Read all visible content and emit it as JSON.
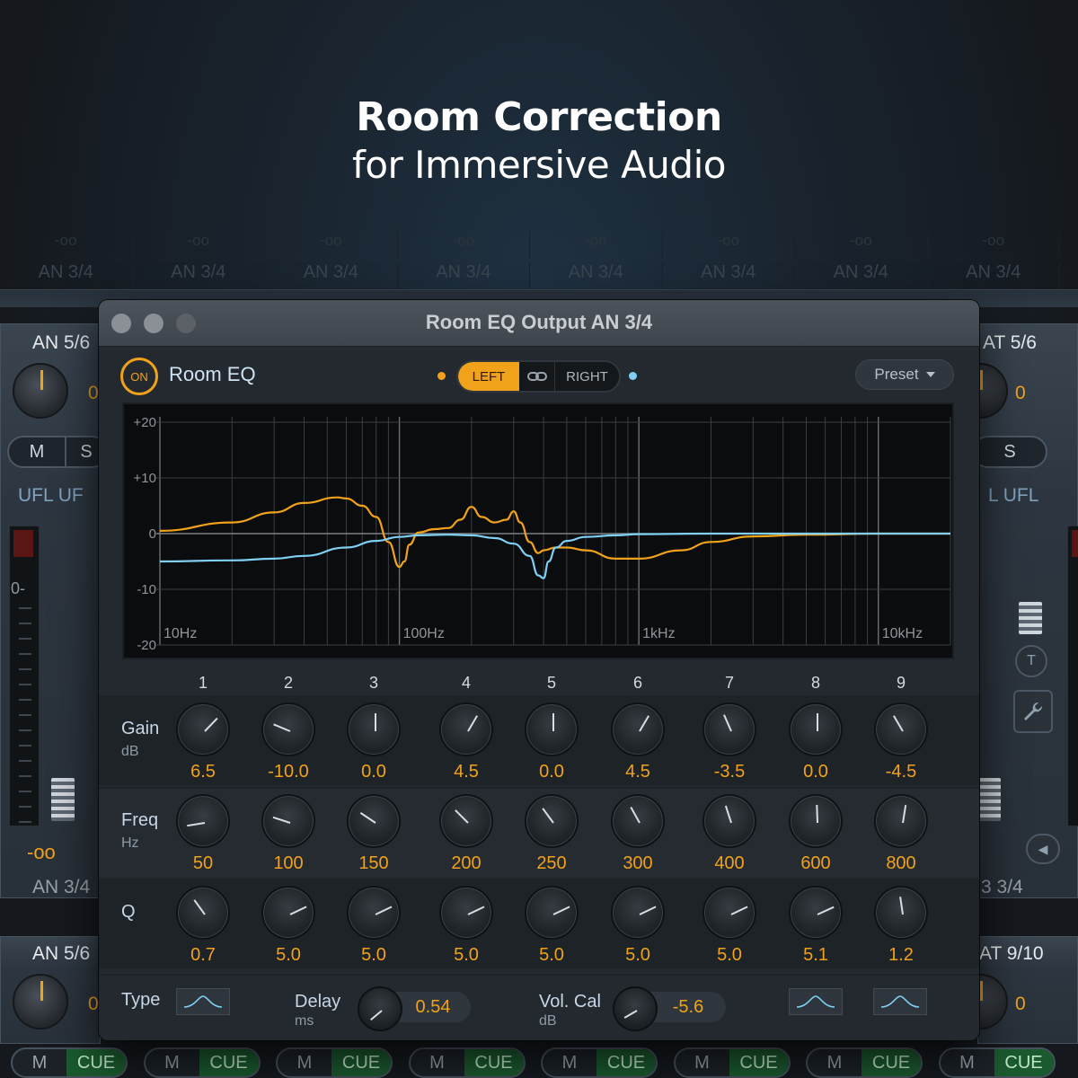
{
  "headline": {
    "line1": "Room Correction",
    "line2": "for Immersive Audio"
  },
  "ghost": {
    "db": [
      "-oo",
      "-oo",
      "-oo",
      "-oo",
      "-oo",
      "-oo",
      "-oo",
      "-oo"
    ],
    "channels": [
      "AN 3/4",
      "AN 3/4",
      "AN 3/4",
      "AN 3/4",
      "AN 3/4",
      "AN 3/4",
      "AN 3/4",
      "AN 3/4"
    ]
  },
  "mixer": {
    "left_strip": {
      "name": "AN 5/6",
      "value": "0",
      "mute": "M",
      "solo": "S",
      "routing": "UFL   UF",
      "meter_zero": "0-",
      "level": "-oo",
      "bottom_name": "AN 3/4",
      "lower_name": "AN 5/6",
      "lower_value": "0"
    },
    "right_strip": {
      "name": "AT 5/6",
      "value": "0",
      "solo": "S",
      "routing": "L  UFL",
      "t_button": "T",
      "bottom_name": "3 3/4",
      "lower_name": "AT 9/10",
      "lower_value": "0"
    },
    "bottom_pills": [
      {
        "m": "M",
        "cue": "CUE"
      },
      {
        "m": "M",
        "cue": "CUE"
      },
      {
        "m": "M",
        "cue": "CUE"
      },
      {
        "m": "M",
        "cue": "CUE"
      },
      {
        "m": "M",
        "cue": "CUE"
      },
      {
        "m": "M",
        "cue": "CUE"
      },
      {
        "m": "M",
        "cue": "CUE"
      },
      {
        "m": "M",
        "cue": "CUE"
      }
    ]
  },
  "window": {
    "title": "Room EQ Output AN 3/4",
    "on_label": "ON",
    "plugin_name": "Room EQ",
    "channel_left": "LEFT",
    "channel_link_icon": "link-icon",
    "channel_right": "RIGHT",
    "preset_label": "Preset"
  },
  "graph": {
    "y_labels": [
      "+20",
      "+10",
      "0",
      "-10",
      "-20"
    ],
    "x_labels": [
      "10Hz",
      "100Hz",
      "1kHz",
      "10kHz"
    ]
  },
  "chart_data": {
    "type": "line",
    "x_scale": "log",
    "xlim_hz": [
      10,
      20000
    ],
    "ylim_db": [
      -20,
      20
    ],
    "series": [
      {
        "color": "#f1a21b",
        "x": [
          10,
          20,
          30,
          40,
          55,
          60,
          70,
          80,
          90,
          100,
          105,
          110,
          120,
          140,
          160,
          180,
          200,
          220,
          250,
          280,
          300,
          320,
          350,
          380,
          400,
          450,
          500,
          600,
          800,
          1000,
          1500,
          2000,
          3000,
          5000,
          10000,
          20000
        ],
        "y": [
          0.5,
          2.0,
          3.8,
          5.5,
          6.5,
          6.3,
          5.0,
          3.0,
          -1.5,
          -6.0,
          -5.0,
          -2.0,
          0.2,
          0.8,
          1.0,
          2.5,
          4.8,
          3.0,
          2.0,
          2.5,
          4.0,
          2.0,
          -1.5,
          -3.5,
          -3.0,
          -2.5,
          -2.5,
          -3.0,
          -4.5,
          -4.5,
          -3.0,
          -1.5,
          -0.5,
          -0.2,
          0.0,
          0.0
        ]
      },
      {
        "color": "#7fd0f4",
        "x": [
          10,
          20,
          30,
          40,
          60,
          80,
          100,
          120,
          160,
          200,
          250,
          300,
          350,
          380,
          400,
          420,
          450,
          500,
          600,
          800,
          1000,
          2000,
          5000,
          20000
        ],
        "y": [
          -5.0,
          -4.8,
          -4.5,
          -4.0,
          -2.5,
          -1.3,
          -0.6,
          -0.3,
          -0.2,
          -0.3,
          -0.8,
          -1.8,
          -4.0,
          -7.5,
          -8.0,
          -5.0,
          -2.5,
          -1.3,
          -0.6,
          -0.3,
          -0.1,
          0.0,
          0.0,
          0.0
        ]
      }
    ]
  },
  "bands": {
    "numbers": [
      "1",
      "2",
      "3",
      "4",
      "5",
      "6",
      "7",
      "8",
      "9"
    ],
    "gain": {
      "label": "Gain",
      "unit": "dB",
      "values": [
        "6.5",
        "-10.0",
        "0.0",
        "4.5",
        "0.0",
        "4.5",
        "-3.5",
        "0.0",
        "-4.5"
      ],
      "levels": [
        6.5,
        -10.0,
        0.0,
        4.5,
        0.0,
        4.5,
        -3.5,
        0.0,
        -4.5
      ],
      "range": [
        -20,
        20
      ]
    },
    "freq": {
      "label": "Freq",
      "unit": "Hz",
      "values": [
        "50",
        "100",
        "150",
        "200",
        "250",
        "300",
        "400",
        "600",
        "800"
      ],
      "levels": [
        50,
        100,
        150,
        200,
        250,
        300,
        400,
        600,
        800
      ]
    },
    "q": {
      "label": "Q",
      "values": [
        "0.7",
        "5.0",
        "5.0",
        "5.0",
        "5.0",
        "5.0",
        "5.0",
        "5.1",
        "1.2"
      ],
      "levels": [
        0.7,
        5.0,
        5.0,
        5.0,
        5.0,
        5.0,
        5.0,
        5.1,
        1.2
      ]
    }
  },
  "footer": {
    "type_label": "Type",
    "delay_label": "Delay",
    "delay_unit": "ms",
    "delay_value": "0.54",
    "volcal_label": "Vol. Cal",
    "volcal_unit": "dB",
    "volcal_value": "-5.6"
  }
}
